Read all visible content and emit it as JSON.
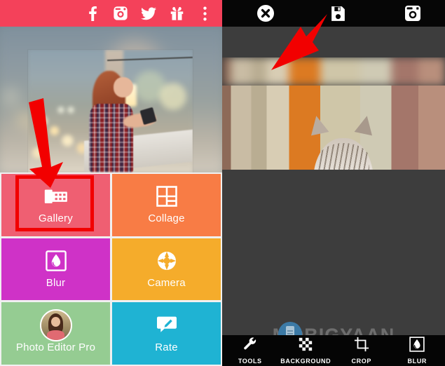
{
  "left_app": {
    "topbar": {
      "icons": [
        {
          "name": "facebook-icon",
          "label": "Facebook"
        },
        {
          "name": "instagram-icon",
          "label": "Instagram"
        },
        {
          "name": "twitter-icon",
          "label": "Twitter"
        },
        {
          "name": "gift-icon",
          "label": "Gift"
        },
        {
          "name": "overflow-menu-icon",
          "label": "More options"
        }
      ],
      "background_color": "#f4415a"
    },
    "hero": {
      "alt": "Woman in plaid shirt using a smartphone on a city street at dusk"
    },
    "tiles": [
      {
        "label": "Gallery",
        "icon": "gallery-icon",
        "color": "#ef5f72"
      },
      {
        "label": "Collage",
        "icon": "collage-icon",
        "color": "#f87c45"
      },
      {
        "label": "Blur",
        "icon": "blur-droplet-icon",
        "color": "#cf32c7"
      },
      {
        "label": "Camera",
        "icon": "camera-aperture-icon",
        "color": "#f5ac2b"
      },
      {
        "label": "Photo Editor Pro",
        "icon": "photo-editor-pro-avatar",
        "color": "#95cc92"
      },
      {
        "label": "Rate",
        "icon": "rate-pencil-icon",
        "color": "#1fb3d3"
      }
    ],
    "annotation": {
      "highlight_color": "#f20000",
      "highlight_target": "Gallery",
      "arrow_color": "#f20000"
    }
  },
  "right_app": {
    "topbar": {
      "icons": [
        {
          "name": "close-icon",
          "label": "Close"
        },
        {
          "name": "save-icon",
          "label": "Save"
        },
        {
          "name": "instagram-share-icon",
          "label": "Share to Instagram"
        }
      ],
      "background_color": "#060606"
    },
    "canvas": {
      "alt": "Cat lying on a concrete ledge, top strip blurred",
      "background_color": "#3d3d3d"
    },
    "watermark": {
      "text": "MOBIGYAAN",
      "logo_color": "#3c7aa6"
    },
    "bottombar": {
      "items": [
        {
          "label": "TOOLS",
          "icon": "wrench-icon"
        },
        {
          "label": "BACKGROUND",
          "icon": "checkerboard-icon"
        },
        {
          "label": "CROP",
          "icon": "crop-icon"
        },
        {
          "label": "BLUR",
          "icon": "blur-droplet-icon"
        }
      ],
      "background_color": "#050505"
    },
    "annotation": {
      "arrow_color": "#f20000",
      "arrow_target": "Save"
    }
  }
}
